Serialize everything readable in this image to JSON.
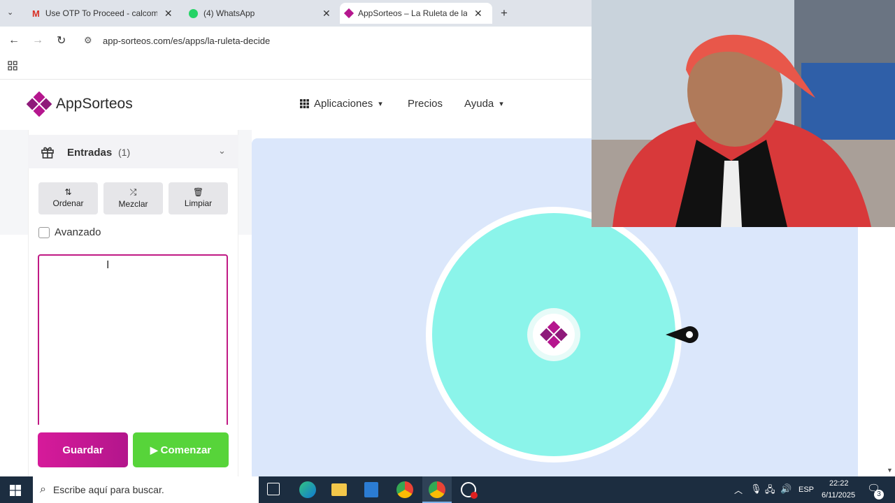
{
  "browser": {
    "tabs": [
      {
        "title": "Use OTP To Proceed - calcoman",
        "icon": "gmail-icon"
      },
      {
        "title": "(4) WhatsApp",
        "icon": "whatsapp-icon"
      },
      {
        "title": "AppSorteos – La Ruleta de la Su",
        "icon": "appsorteos-icon"
      }
    ],
    "close": "✕",
    "new_tab": "+",
    "url": "app-sorteos.com/es/apps/la-ruleta-decide"
  },
  "site": {
    "brand": "AppSorteos",
    "nav": {
      "apps": "Aplicaciones",
      "pricing": "Precios",
      "help": "Ayuda"
    }
  },
  "panel": {
    "entries_label": "Entradas",
    "entries_count": "(1)",
    "buttons": {
      "sort": "Ordenar",
      "shuffle": "Mezclar",
      "clear": "Limpiar"
    },
    "advanced": "Avanzado",
    "save": "Guardar",
    "start": "Comenzar"
  },
  "wheel": {
    "color": "#8bf4ea",
    "accent": "#b5168e"
  },
  "taskbar": {
    "search_placeholder": "Escribe aquí para buscar.",
    "lang": "ESP",
    "time": "22:22",
    "date": "6/11/2025",
    "notifications": "3"
  }
}
